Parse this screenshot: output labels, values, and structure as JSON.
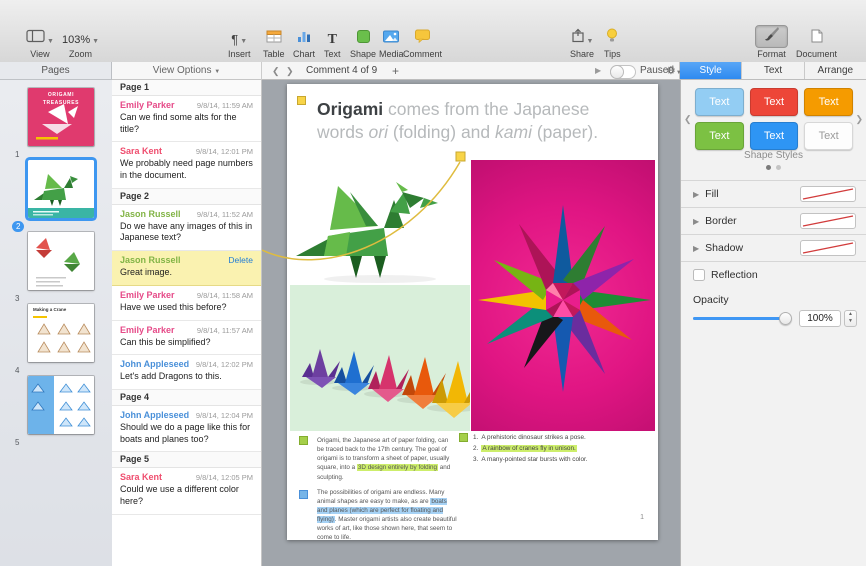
{
  "toolbar": {
    "view": {
      "label": "View"
    },
    "zoom": {
      "label": "Zoom",
      "value": "103%"
    },
    "insert": {
      "label": "Insert",
      "glyph": "¶"
    },
    "table": {
      "label": "Table"
    },
    "chart": {
      "label": "Chart"
    },
    "text": {
      "label": "Text",
      "glyph": "T"
    },
    "shape": {
      "label": "Shape"
    },
    "media": {
      "label": "Media"
    },
    "comment": {
      "label": "Comment"
    },
    "share": {
      "label": "Share"
    },
    "tips": {
      "label": "Tips"
    },
    "format": {
      "label": "Format"
    },
    "document": {
      "label": "Document"
    }
  },
  "sidebar": {
    "header": "Pages",
    "thumb1_title_line1": "ORIGAMI",
    "thumb1_title_line2": "TREASURES",
    "thumb4_title": "Making a Crane",
    "pages": [
      {
        "number": "1",
        "selected": false
      },
      {
        "number": "2",
        "selected": true
      },
      {
        "number": "3",
        "selected": false
      },
      {
        "number": "4",
        "selected": false
      },
      {
        "number": "5",
        "selected": false
      }
    ]
  },
  "comments": {
    "header": "View Options",
    "items": [
      {
        "type": "page",
        "label": "Page 1"
      },
      {
        "type": "comment",
        "author": "Emily Parker",
        "author_color": "#e64a88",
        "time": "9/8/14, 11:59 AM",
        "text": "Can we find some alts for the title?"
      },
      {
        "type": "comment",
        "author": "Sara Kent",
        "author_color": "#ef4d6e",
        "time": "9/8/14, 12:01 PM",
        "text": "We probably need page numbers in the document."
      },
      {
        "type": "page",
        "label": "Page 2"
      },
      {
        "type": "comment",
        "author": "Jason Russell",
        "author_color": "#82b446",
        "time": "9/8/14, 11:52 AM",
        "text": "Do we have any images of this in Japanese text?"
      },
      {
        "type": "comment",
        "author": "Jason Russell",
        "author_color": "#82b446",
        "action": "Delete",
        "text": "Great image.",
        "highlighted": true
      },
      {
        "type": "comment",
        "author": "Emily Parker",
        "author_color": "#e64a88",
        "time": "9/8/14, 11:58 AM",
        "text": "Have we used this before?"
      },
      {
        "type": "comment",
        "author": "Emily Parker",
        "author_color": "#e64a88",
        "time": "9/8/14, 11:57 AM",
        "text": "Can this be simplified?"
      },
      {
        "type": "comment",
        "author": "John Appleseed",
        "author_color": "#4a90d9",
        "time": "9/8/14, 12:02 PM",
        "text": "Let's add Dragons to this."
      },
      {
        "type": "page",
        "label": "Page 4"
      },
      {
        "type": "comment",
        "author": "John Appleseed",
        "author_color": "#4a90d9",
        "time": "9/8/14, 12:04 PM",
        "text": "Should we do a page like this for boats and planes too?"
      },
      {
        "type": "page",
        "label": "Page 5"
      },
      {
        "type": "comment",
        "author": "Sara Kent",
        "author_color": "#ef4d6e",
        "time": "9/8/14, 12:05 PM",
        "text": "Could we use a different color here?"
      }
    ]
  },
  "comment_bar": {
    "position": "Comment 4 of 9",
    "add": "+",
    "paused_label": "Paused"
  },
  "inspector": {
    "tabs": [
      {
        "label": "Style",
        "active": true
      },
      {
        "label": "Text",
        "active": false
      },
      {
        "label": "Arrange",
        "active": false
      }
    ],
    "presets": [
      {
        "label": "Text",
        "bg": "#93cdf3",
        "fg": "#ffffff"
      },
      {
        "label": "Text",
        "bg": "#ed4638",
        "fg": "#ffffff"
      },
      {
        "label": "Text",
        "bg": "#f59b00",
        "fg": "#ffffff"
      },
      {
        "label": "Text",
        "bg": "#7cc143",
        "fg": "#ffffff"
      },
      {
        "label": "Text",
        "bg": "#2e95f4",
        "fg": "#ffffff"
      },
      {
        "label": "Text",
        "bg": "#fdfdfd",
        "fg": "#9a9a9a"
      }
    ],
    "shape_styles_label": "Shape Styles",
    "fill_label": "Fill",
    "border_label": "Border",
    "shadow_label": "Shadow",
    "reflection_label": "Reflection",
    "opacity_label": "Opacity",
    "opacity_value": "100%"
  },
  "doc": {
    "heading": {
      "s1": "Origami",
      "s2": " comes from the Japanese words ",
      "s3": "ori",
      "s4": " (folding) and ",
      "s5": "kami",
      "s6": " (paper)."
    },
    "para1": {
      "s1": "Origami, the Japanese art of paper folding, can be traced back to the 17th century. The goal of origami is to transform a sheet of paper, usually square, into a ",
      "s2": "3D design entirely by folding",
      "s3": " and sculpting."
    },
    "para2": {
      "s1": "The possibilities of origami are endless. Many animal shapes are easy to make, as are ",
      "s2": "boats and planes (which are perfect for floating and flying)",
      "s3": ". Master origami artists also create beautiful works of art, like those shown here, that seem to come to life."
    },
    "list": [
      {
        "num": "1.",
        "text": "A prehistoric dinosaur strikes a pose.",
        "highlight": false
      },
      {
        "num": "2.",
        "text": "A rainbow of cranes fly in unison.",
        "highlight": true
      },
      {
        "num": "3.",
        "text": "A many-pointed star bursts with color.",
        "highlight": false
      }
    ],
    "page_number": "1",
    "colors": {
      "highlight_green": "#cdee6b",
      "highlight_blue": "#a6d2f5",
      "connector_yellow": "#dfbc3f"
    }
  }
}
